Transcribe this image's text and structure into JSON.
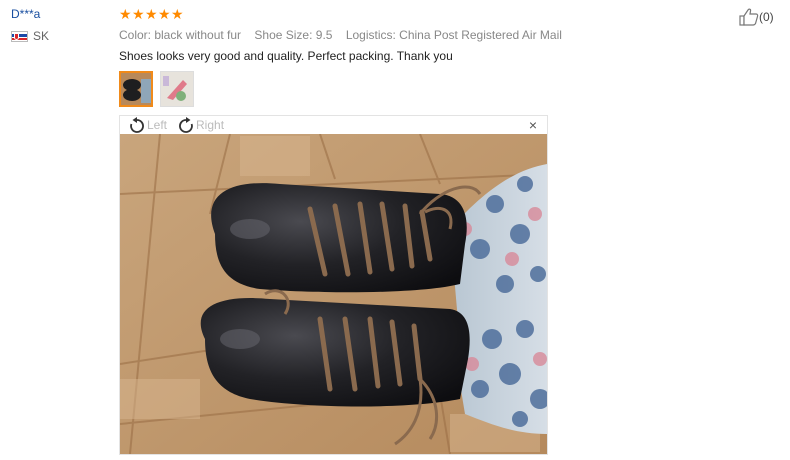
{
  "reviewer": {
    "name": "D***a",
    "country_code": "SK",
    "flag_icon": "slovakia-flag-icon"
  },
  "review": {
    "rating_stars": 5,
    "color": "Color: black without fur",
    "shoe_size": "Shoe Size: 9.5",
    "logistics": "Logistics: China Post Registered Air Mail",
    "text": "Shoes looks very good and quality. Perfect packing. Thank you"
  },
  "viewer": {
    "rotate_left_label": "Left",
    "rotate_right_label": "Right",
    "close_glyph": "×"
  },
  "helpful": {
    "count": "(0)"
  },
  "colors": {
    "star": "#ff8a00",
    "active_thumb_border": "#f08a1a",
    "username": "#1a4fa0"
  }
}
